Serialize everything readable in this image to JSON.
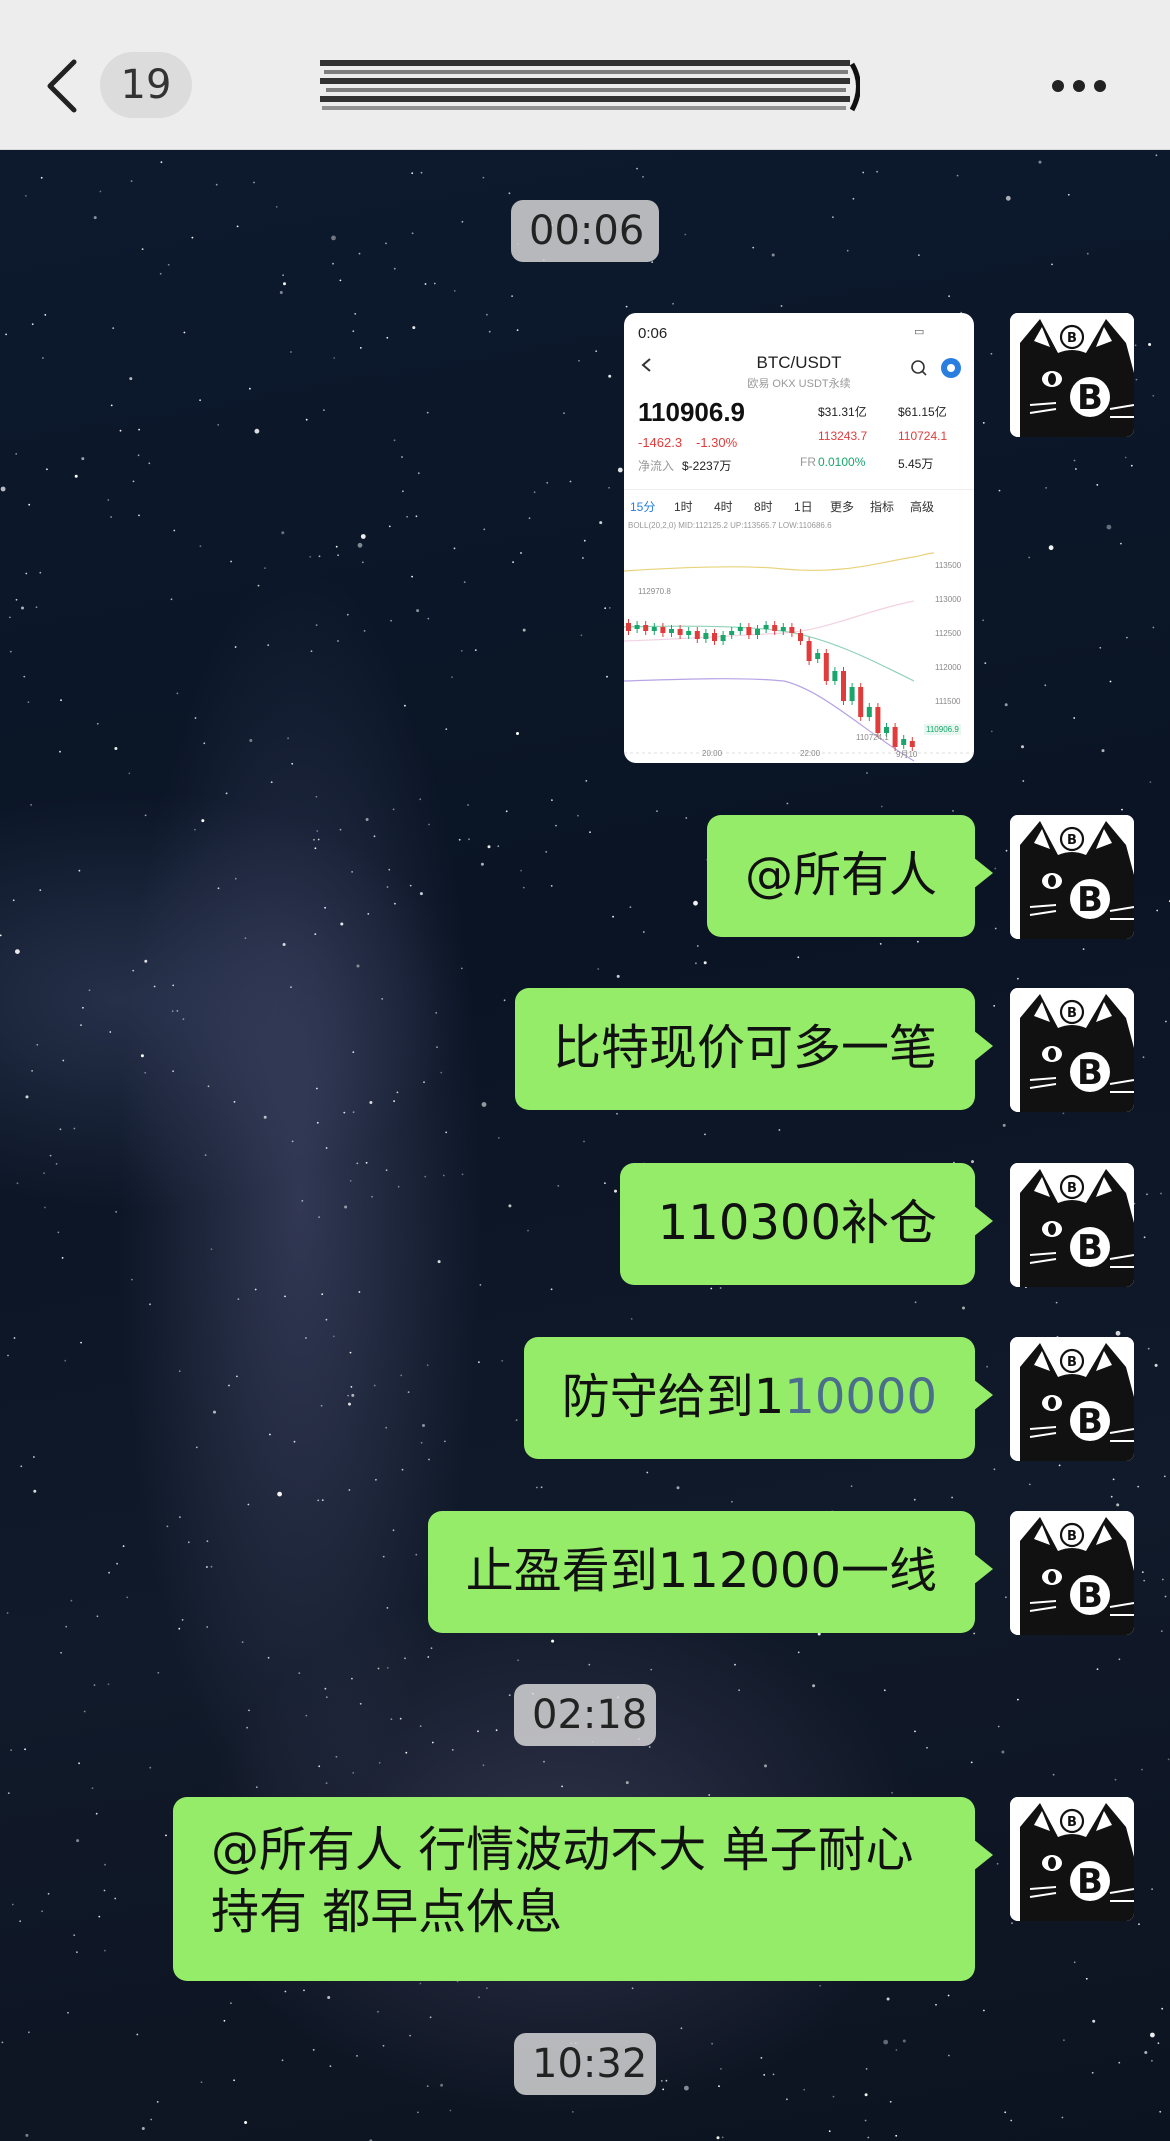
{
  "header": {
    "back_icon": "chevron-left-icon",
    "unread_count": "19",
    "title": "",
    "more_icon": "more-horizontal-icon"
  },
  "timestamps": [
    "00:06",
    "02:18",
    "10:32"
  ],
  "image_message": {
    "status_time": "0:06",
    "pair": "BTC/USDT",
    "pair_sub": "欧易 OKX USDT永续",
    "last_price": "110906.9",
    "change": "-1462.3",
    "change_pct": "-1.30%",
    "net_inflow_label": "净流入",
    "net_inflow": "$-2237万",
    "stat_1": "$31.31亿",
    "stat_2": "$61.15亿",
    "high": "113243.7",
    "low": "110724.1",
    "funding_label": "FR",
    "funding": "0.0100%",
    "stat_3": "5.45万",
    "tabs": [
      "15分",
      "1时",
      "4时",
      "8时",
      "1日",
      "更多",
      "指标",
      "高级"
    ],
    "boll_line": "BOLL(20,2,0) MID:112125.2 UP:113565.7 LOW:110686.6",
    "y_axis": [
      "113500",
      "113000",
      "112500",
      "112000",
      "111500"
    ],
    "x_axis": [
      "20:00",
      "22:00",
      "9月10"
    ],
    "chart_high_marker": "112970.8",
    "chart_low_marker": "110724.1",
    "current_price_tag": "110906.9"
  },
  "messages": [
    {
      "text": "@所有人"
    },
    {
      "text": "比特现价可多一笔"
    },
    {
      "text": "110300补仓"
    },
    {
      "text_prefix": "防守给到1",
      "text_link": "10000"
    },
    {
      "text": "止盈看到112000一线"
    },
    {
      "text": "@所有人 行情波动不大 单子耐心持有 都早点休息"
    }
  ],
  "avatar": {
    "icon": "black-cat-bitcoin-avatar"
  },
  "colors": {
    "bubble": "#95ec69",
    "header_bg": "#ededed",
    "link_digits": "#4a6e8c",
    "price_down": "#e03c3c",
    "price_up": "#1aa56a"
  }
}
